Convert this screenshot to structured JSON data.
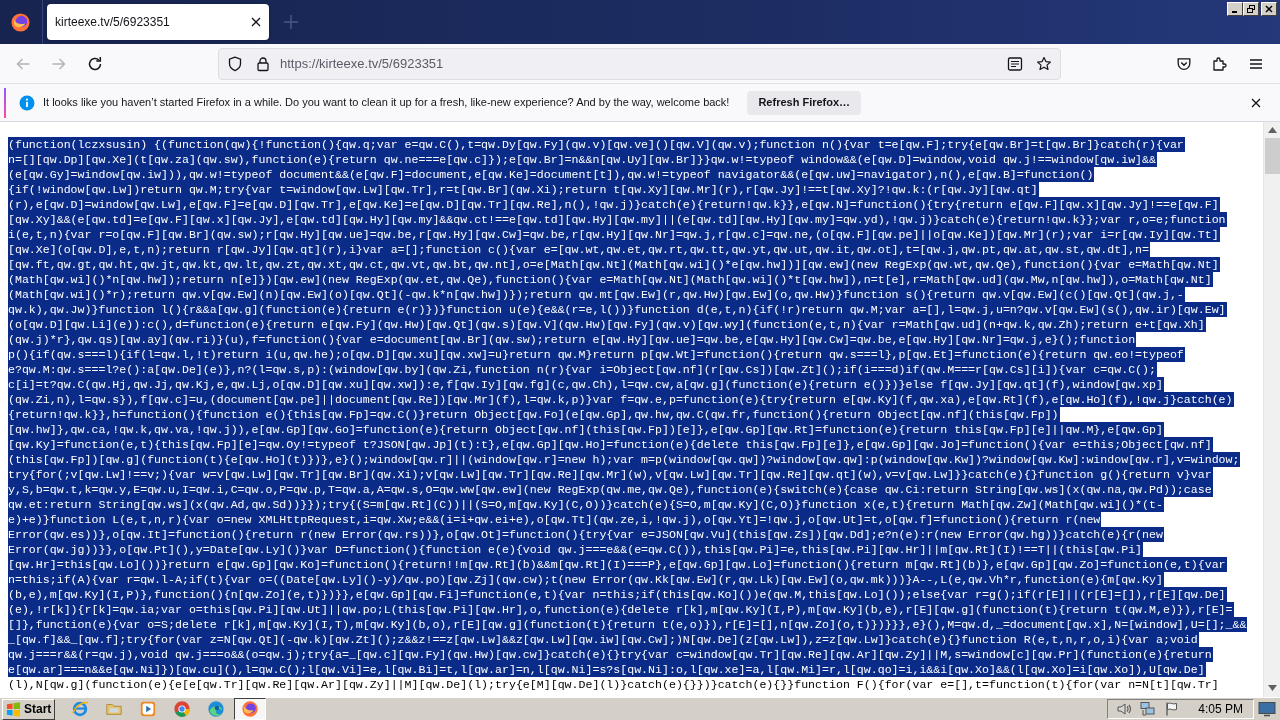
{
  "browser": {
    "tabs": [
      {
        "title": "kirteexe.tv/5/6923351",
        "selected": true
      }
    ],
    "navigation": {
      "back_disabled": true,
      "forward_disabled": true
    },
    "address_bar": {
      "url": "https://kirteexe.tv/5/6923351"
    }
  },
  "notification": {
    "message": "It looks like you haven’t started Firefox in a while. Do you want to clean it up for a fresh, like-new experience? And by the way, welcome back!",
    "button": "Refresh Firefox…"
  },
  "page": {
    "lines": [
      {
        "text": "(function(lczxsusin) {(function(qw){!function(){qw.q;var e=qw.C(),t=qw.Dy[qw.Fy](qw.v)[qw.ve]()[qw.V](qw.v);function n(){var t=e[qw.F];try{e[qw.Br]=t[qw.Br]}catch(r){var",
        "selected": true
      },
      {
        "text": "n=[][qw.Dp][qw.Xe](t[qw.za](qw.sw),function(e){return qw.ne===e[qw.c]});e[qw.Br]=n&&n[qw.Uy][qw.Br]}}qw.w!=typeof window&&(e[qw.D]=window,void qw.j!==window[qw.iw]&&",
        "selected": true
      },
      {
        "text": "(e[qw.Gy]=window[qw.iw])),qw.w!=typeof document&&(e[qw.F]=document,e[qw.Ke]=document[t]),qw.w!=typeof navigator&&(e[qw.uw]=navigator),n(),e[qw.B]=function()",
        "selected": true
      },
      {
        "text": "{if(!window[qw.Lw])return qw.M;try{var t=window[qw.Lw][qw.Tr],r=t[qw.Br](qw.Xi);return t[qw.Xy][qw.Mr](r),r[qw.Jy]!==t[qw.Xy]?!qw.k:(r[qw.Jy][qw.qt]",
        "selected": true
      },
      {
        "text": "(r),e[qw.D]=window[qw.Lw],e[qw.F]=e[qw.D][qw.Tr],e[qw.Ke]=e[qw.D][qw.Tr][qw.Re],n(),!qw.j)}catch(e){return!qw.k}},e[qw.N]=function(){try{return e[qw.F][qw.x][qw.Jy]!==e[qw.F]",
        "selected": true
      },
      {
        "text": "[qw.Xy]&&(e[qw.td]=e[qw.F][qw.x][qw.Jy],e[qw.td][qw.Hy][qw.my]&&qw.ct!==e[qw.td][qw.Hy][qw.my]||(e[qw.td][qw.Hy][qw.my]=qw.yd),!qw.j)}catch(e){return!qw.k}};var r,o=e;function",
        "selected": true
      },
      {
        "text": "i(e,t,n){var r=o[qw.F][qw.Br](qw.sw);r[qw.Hy][qw.ue]=qw.be,r[qw.Hy][qw.Cw]=qw.be,r[qw.Hy][qw.Nr]=qw.j,r[qw.c]=qw.ne,(o[qw.F][qw.pe]||o[qw.Ke])[qw.Mr](r);var i=r[qw.Iy][qw.Tt]",
        "selected": true
      },
      {
        "text": "[qw.Xe](o[qw.D],e,t,n);return r[qw.Jy][qw.qt](r),i}var a=[];function c(){var e=[qw.wt,qw.et,qw.rt,qw.tt,qw.yt,qw.ut,qw.it,qw.ot],t=[qw.j,qw.pt,qw.at,qw.st,qw.dt],n=",
        "selected": true
      },
      {
        "text": "[qw.ft,qw.gt,qw.ht,qw.jt,qw.kt,qw.lt,qw.zt,qw.xt,qw.ct,qw.vt,qw.bt,qw.nt],o=e[Math[qw.Nt](Math[qw.wi]()*e[qw.hw])][qw.ew](new RegExp(qw.wt,qw.Qe),function(){var e=Math[qw.Nt]",
        "selected": true
      },
      {
        "text": "(Math[qw.wi]()*n[qw.hw]);return n[e]})[qw.ew](new RegExp(qw.et,qw.Qe),function(){var e=Math[qw.Nt](Math[qw.wi]()*t[qw.hw]),n=t[e],r=Math[qw.ud](qw.Mw,n[qw.hw]),o=Math[qw.Nt]",
        "selected": true
      },
      {
        "text": "(Math[qw.wi]()*r);return qw.v[qw.Ew](n)[qw.Ew](o)[qw.Qt](-qw.k*n[qw.hw])});return qw.mt[qw.Ew](r,qw.Hw)[qw.Ew](o,qw.Hw)}function s(){return qw.v[qw.Ew](c()[qw.Qt](qw.j,-",
        "selected": true
      },
      {
        "text": "qw.k),qw.Jw)}function l(){r&&a[qw.g](function(e){return e(r)})}function u(e){e&&(r=e,l())}function d(e,t,n){if(!r)return qw.M;var a=[],l=qw.j,u=n?qw.v[qw.Ew](s(),qw.ir)[qw.Ew]",
        "selected": true
      },
      {
        "text": "(o[qw.D][qw.Li](e)):c(),d=function(e){return e[qw.Fy](qw.Hw)[qw.Qt](qw.s)[qw.V](qw.Hw)[qw.Fy](qw.v)[qw.wy](function(e,t,n){var r=Math[qw.ud](n+qw.k,qw.Zh);return e+t[qw.Xh]",
        "selected": true
      },
      {
        "text": "(qw.j)*r},qw.qs)[qw.ay](qw.ri)}(u),f=function(){var e=document[qw.Br](qw.sw);return e[qw.Hy][qw.ue]=qw.be,e[qw.Hy][qw.Cw]=qw.be,e[qw.Hy][qw.Nr]=qw.j,e}();function",
        "selected": true
      },
      {
        "text": "p(){if(qw.s===l){if(l=qw.l,!t)return i(u,qw.he);o[qw.D][qw.xu][qw.xw]=u}return qw.M}return p[qw.Wt]=function(){return qw.s===l},p[qw.Et]=function(e){return qw.eo!=typeof",
        "selected": true
      },
      {
        "text": "e?qw.M:qw.s===l?e():a[qw.De](e)},n?(l=qw.s,p):(window[qw.by](qw.Zi,function n(r){var i=Object[qw.nf](r[qw.Cs])[qw.Zt]();if(i===d)if(qw.M===r[qw.Cs][i]){var c=qw.C();",
        "selected": true
      },
      {
        "text": "c[i]=t?qw.C(qw.Hj,qw.Jj,qw.Kj,e,qw.Lj,o[qw.D][qw.xu][qw.xw]):e,f[qw.Iy][qw.fg](c,qw.Ch),l=qw.cw,a[qw.g](function(e){return e()})}else f[qw.Jy][qw.qt](f),window[qw.xp]",
        "selected": true
      },
      {
        "text": "(qw.Zi,n),l=qw.s}),f[qw.c]=u,(document[qw.pe]||document[qw.Re])[qw.Mr](f),l=qw.k,p)}var f=qw.e,p=function(e){try{return e[qw.Ky](f,qw.xa),e[qw.Rt](f),e[qw.Ho](f),!qw.j}catch(e)",
        "selected": true
      },
      {
        "text": "{return!qw.k}},h=function(){function e(){this[qw.Fp]=qw.C()}return Object[qw.Fo](e[qw.Gp],qw.hw,qw.C(qw.fr,function(){return Object[qw.nf](this[qw.Fp])",
        "selected": true
      },
      {
        "text": "[qw.hw]},qw.ca,!qw.k,qw.va,!qw.j)),e[qw.Gp][qw.Go]=function(e){return Object[qw.nf](this[qw.Fp])[e]},e[qw.Gp][qw.Rt]=function(e){return this[qw.Fp][e]||qw.M},e[qw.Gp]",
        "selected": true
      },
      {
        "text": "[qw.Ky]=function(e,t){this[qw.Fp][e]=qw.Oy!=typeof t?JSON[qw.Jp](t):t},e[qw.Gp][qw.Ho]=function(e){delete this[qw.Fp][e]},e[qw.Gp][qw.Jo]=function(){var e=this;Object[qw.nf]",
        "selected": true
      },
      {
        "text": "(this[qw.Fp])[qw.g](function(t){e[qw.Ho](t)})},e}();window[qw.r]||(window[qw.r]=new h);var m=p(window[qw.qw])?window[qw.qw]:p(window[qw.Kw])?window[qw.Kw]:window[qw.r],v=window;",
        "selected": true
      },
      {
        "text": "try{for(;v[qw.Lw]!==v;){var w=v[qw.Lw][qw.Tr][qw.Br](qw.Xi);v[qw.Lw][qw.Tr][qw.Re][qw.Mr](w),v[qw.Lw][qw.Tr][qw.Re][qw.qt](w),v=v[qw.Lw]}}catch(e){}function g(){return v}var",
        "selected": true
      },
      {
        "text": "y,S,b=qw.t,k=qw.y,E=qw.u,I=qw.i,C=qw.o,P=qw.p,T=qw.a,A=qw.s,O=qw.ww[qw.ew](new RegExp(qw.me,qw.Qe),function(e){switch(e){case qw.Ci:return String[qw.ws](x(qw.na,qw.Pd));case",
        "selected": true
      },
      {
        "text": "qw.et:return String[qw.ws](x(qw.Ad,qw.Sd))}});try{(S=m[qw.Rt](C))||(S=O,m[qw.Ky](C,O))}catch(e){S=O,m[qw.Ky](C,O)}function x(e,t){return Math[qw.Zw](Math[qw.wi]()*(t-",
        "selected": true
      },
      {
        "text": "e)+e)}function L(e,t,n,r){var o=new XMLHttpRequest,i=qw.Xw;e&&(i=i+qw.ei+e),o[qw.Tt](qw.ze,i,!qw.j),o[qw.Yt]=!qw.j,o[qw.Ut]=t,o[qw.f]=function(){return r(new",
        "selected": true
      },
      {
        "text": "Error(qw.es))},o[qw.It]=function(){return r(new Error(qw.rs))},o[qw.Ot]=function(){try{var e=JSON[qw.Vu](this[qw.Zs])[qw.Dd];e?n(e):r(new Error(qw.hg))}catch(e){r(new",
        "selected": true
      },
      {
        "text": "Error(qw.jg))}},o[qw.Pt](),y=Date[qw.Ly]()}var D=function(){function e(e){void qw.j===e&&(e=qw.C()),this[qw.Pi]=e,this[qw.Pi][qw.Hr]||m[qw.Rt](I)!==T||(this[qw.Pi]",
        "selected": true
      },
      {
        "text": "[qw.Hr]=this[qw.Lo]())}return e[qw.Gp][qw.Ko]=function(){return!!m[qw.Rt](b)&&m[qw.Rt](I)===P},e[qw.Gp][qw.Lo]=function(){return m[qw.Rt](b)},e[qw.Gp][qw.Zo]=function(e,t){var",
        "selected": true
      },
      {
        "text": "n=this;if(A){var r=qw.l-A;if(t){var o=((Date[qw.Ly]()-y)/qw.po)[qw.Zj](qw.cw);t(new Error(qw.Kk[qw.Ew](r,qw.Lk)[qw.Ew](o,qw.mk)))}A--,L(e,qw.Vh*r,function(e){m[qw.Ky]",
        "selected": true
      },
      {
        "text": "(b,e),m[qw.Ky](I,P)},function(){n[qw.Zo](e,t)})}},e[qw.Gp][qw.Fi]=function(e,t){var n=this;if(this[qw.Ko]())e(qw.M,this[qw.Lo]());else{var r=g();if(r[E]||(r[E]=[]),r[E][qw.De]",
        "selected": true
      },
      {
        "text": "(e),!r[k]){r[k]=qw.ia;var o=this[qw.Pi][qw.Ut]||qw.po;L(this[qw.Pi][qw.Hr],o,function(e){delete r[k],m[qw.Ky](I,P),m[qw.Ky](b,e),r[E][qw.g](function(t){return t(qw.M,e)}),r[E]=",
        "selected": true
      },
      {
        "text": "[]},function(e){var o=S;delete r[k],m[qw.Ky](I,T),m[qw.Ky](b,o),r[E][qw.g](function(t){return t(e,o)}),r[E]=[],n[qw.Zo](o,t)})}}},e}(),M=qw.d,_=document[qw.x],N=[window],U=[];_&&",
        "selected": true
      },
      {
        "text": "_[qw.f]&&_[qw.f];try{for(var z=N[qw.Qt](-qw.k)[qw.Zt]();z&&z!==z[qw.Lw]&&z[qw.Lw][qw.iw][qw.Cw];)N[qw.De](z[qw.Lw]),z=z[qw.Lw]}catch(e){}function R(e,t,n,r,o,i){var a;void",
        "selected": true
      },
      {
        "text": "qw.j===r&&(r=qw.j),void qw.j===o&&(o=qw.j);try{a=_[qw.c][qw.Fy](qw.Hw)[qw.cw]}catch(e){}try{var c=window[qw.Tr][qw.Re][qw.Ar][qw.Zy]||M,s=window[c][qw.Pr](function(e){return",
        "selected": true
      },
      {
        "text": "e[qw.ar]===n&&e[qw.Ni]})[qw.cu](),l=qw.C();l[qw.Vi]=e,l[qw.Bi]=t,l[qw.ar]=n,l[qw.Ni]=s?s[qw.Ni]:o,l[qw.xe]=a,l[qw.Mi]=r,l[qw.qo]=i,i&&i[qw.Xo]&&(l[qw.Xo]=i[qw.Xo]),U[qw.De]",
        "selected": true
      },
      {
        "text": "(l),N[qw.g](function(e){e[e[qw.Tr][qw.Re][qw.Ar][qw.Zy]||M][qw.De](l);try{e[M][qw.De](l)}catch(e){}})}catch(e){}}function F(){for(var e=[],t=function(t){for(var n=N[t][qw.Tr]",
        "selected": false
      }
    ]
  },
  "taskbar": {
    "start": "Start",
    "apps": [
      {
        "kind": "ie",
        "active": false
      },
      {
        "kind": "explorer",
        "active": false
      },
      {
        "kind": "media",
        "active": false
      },
      {
        "kind": "chrome",
        "active": false
      },
      {
        "kind": "edge",
        "active": false
      },
      {
        "kind": "firefox",
        "active": true
      }
    ],
    "clock": "4:05 PM"
  }
}
